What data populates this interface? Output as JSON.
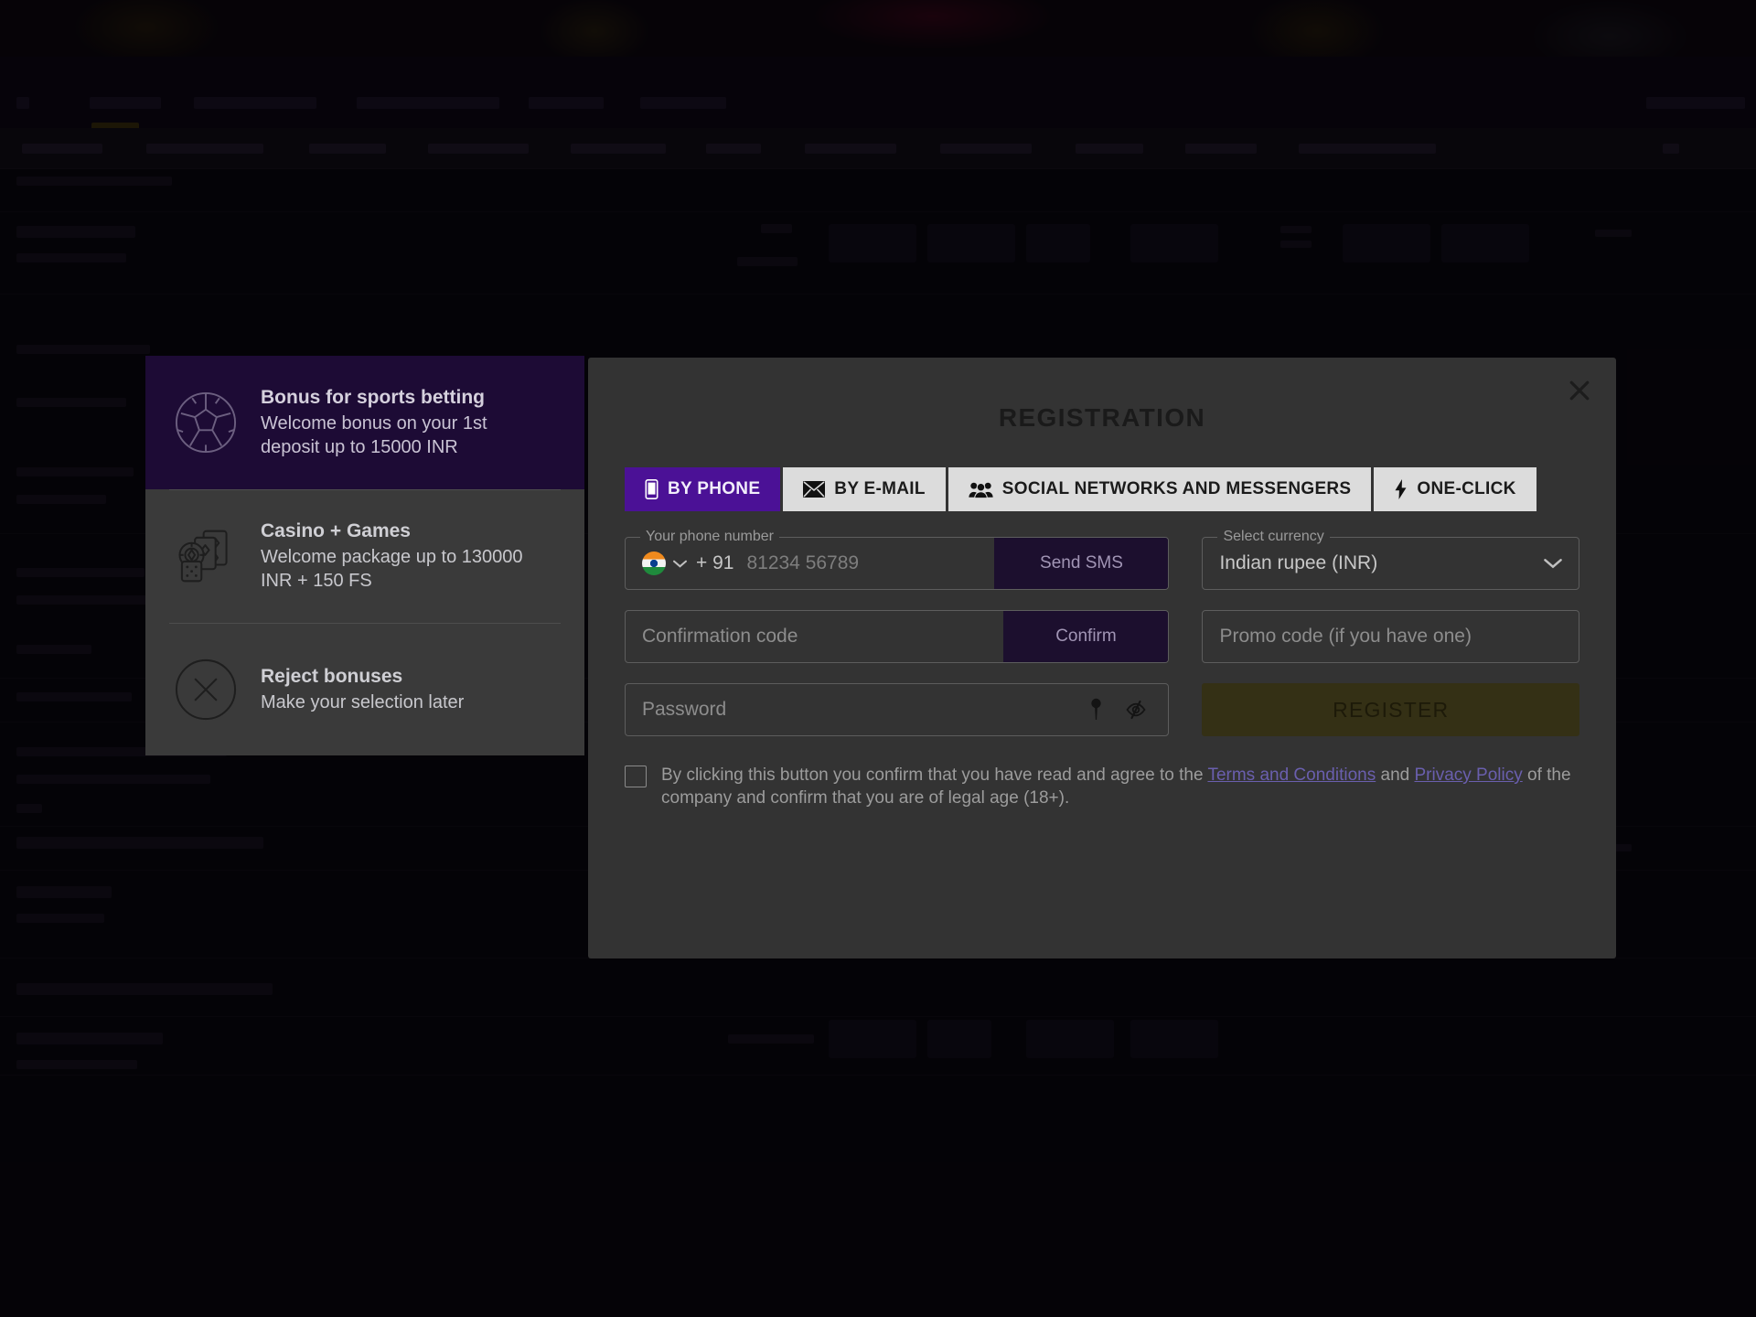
{
  "dialog": {
    "title": "REGISTRATION",
    "close_label": "×",
    "accent_purple": "#4b1196",
    "panel_bg": "#333333",
    "register_bg": "#343015"
  },
  "bonus_panel": {
    "items": [
      {
        "icon": "soccer-ball-icon",
        "title": "Bonus for sports betting",
        "desc": "Welcome bonus on your 1st deposit up to 15000 INR",
        "selected": true
      },
      {
        "icon": "casino-cards-icon",
        "title": "Casino + Games",
        "desc": "Welcome package up to 130000 INR + 150 FS",
        "selected": false
      },
      {
        "icon": "reject-circle-x-icon",
        "title": "Reject bonuses",
        "desc": "Make your selection later",
        "selected": false
      }
    ]
  },
  "tabs": [
    {
      "id": "by-phone",
      "label": "BY PHONE",
      "icon": "mobile-phone-icon",
      "active": true
    },
    {
      "id": "by-email",
      "label": "BY E-MAIL",
      "icon": "envelope-icon",
      "active": false
    },
    {
      "id": "social",
      "label": "SOCIAL NETWORKS AND MESSENGERS",
      "icon": "people-group-icon",
      "active": false
    },
    {
      "id": "one-click",
      "label": "ONE-CLICK",
      "icon": "lightning-bolt-icon",
      "active": false
    }
  ],
  "form": {
    "phone": {
      "legend": "Your phone number",
      "country_flag": "india-flag-icon",
      "dial_code": "+ 91",
      "placeholder": "81234 56789",
      "value": "",
      "send_sms_label": "Send SMS"
    },
    "currency": {
      "legend": "Select currency",
      "value": "Indian rupee (INR)"
    },
    "confirmation": {
      "placeholder": "Confirmation code",
      "value": "",
      "confirm_label": "Confirm"
    },
    "promo": {
      "placeholder": "Promo code (if you have one)",
      "value": ""
    },
    "password": {
      "placeholder": "Password",
      "value": "",
      "generate_icon": "key-icon",
      "visibility_icon": "eye-slash-icon"
    },
    "register_label": "REGISTER"
  },
  "terms": {
    "checked": false,
    "part1": "By clicking this button you confirm that you have read and agree to the ",
    "link1": "Terms and Conditions",
    "part2": " and ",
    "link2": "Privacy Policy",
    "part3": " of the company and confirm that you are of legal age (18+)."
  }
}
